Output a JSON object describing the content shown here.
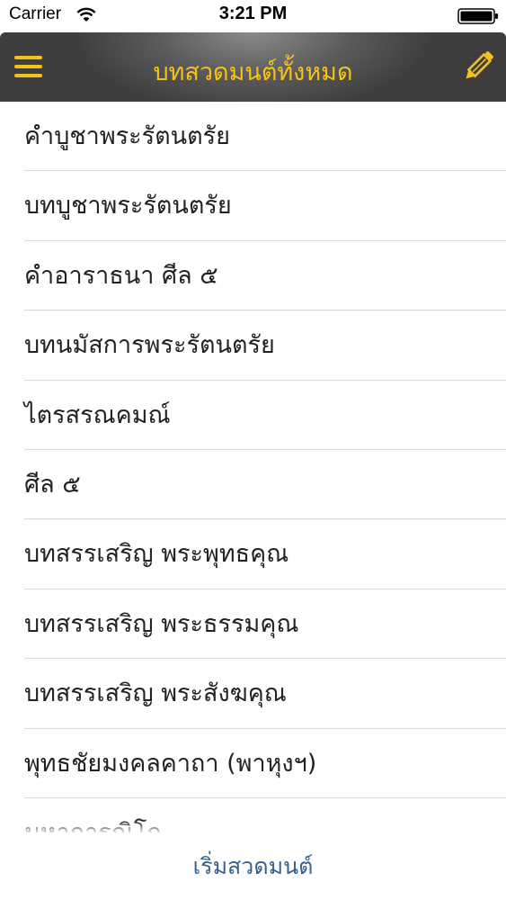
{
  "status_bar": {
    "carrier": "Carrier",
    "time": "3:21 PM"
  },
  "nav": {
    "title": "บทสวดมนต์ทั้งหมด",
    "accent_color": "#f4c21a",
    "left_icon": "hamburger-menu-icon",
    "right_icon": "pencil-edit-icon"
  },
  "list": {
    "items": [
      "คำบูชาพระรัตนตรัย",
      "บทบูชาพระรัตนตรัย",
      "คำอาราธนา ศีล ๕",
      "บทนมัสการพระรัตนตรัย",
      "ไตรสรณคมณ์",
      "ศีล ๕",
      "บทสรรเสริญ พระพุทธคุณ",
      "บทสรรเสริญ พระธรรมคุณ",
      "บทสรรเสริญ พระสังฆคุณ",
      "พุทธชัยมงคลคาถา (พาหุงฯ)",
      "มหาการุณิโก"
    ]
  },
  "bottom": {
    "start_label": "เริ่มสวดมนต์",
    "link_color": "#35618e"
  }
}
